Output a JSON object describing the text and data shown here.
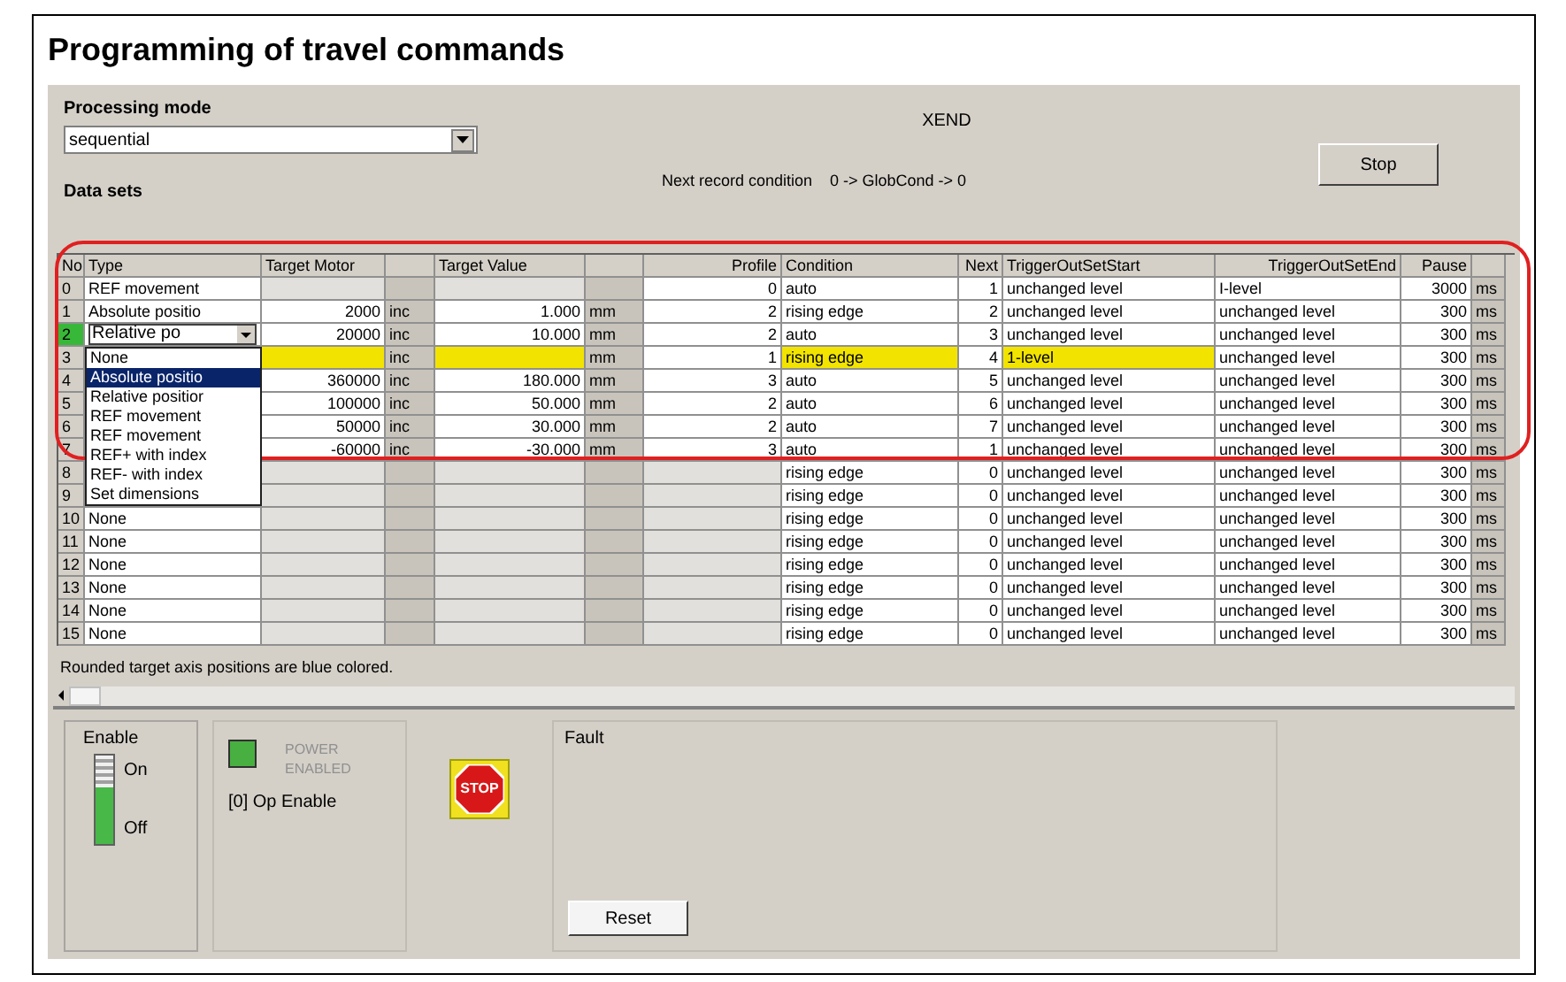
{
  "title": "Programming of travel commands",
  "processing_mode": {
    "label": "Processing mode",
    "value": "sequential"
  },
  "status": "XEND",
  "next_record_condition": {
    "label": "Next record condition",
    "value": "0 -> GlobCond -> 0"
  },
  "stop_button": "Stop",
  "data_sets": {
    "label": "Data sets",
    "columns": [
      "No",
      "Type",
      "Target Motor",
      "Target Value",
      "Profile",
      "Condition",
      "Next",
      "TriggerOutSetStart",
      "TriggerOutSetEnd",
      "Pause"
    ],
    "rows": [
      {
        "no": "0",
        "type": "REF movement",
        "profile": "0",
        "condition": "auto",
        "next": "1",
        "start": "unchanged level",
        "end": "I-level",
        "pause": "3000",
        "pause_unit": "ms",
        "selected": false,
        "warning": false
      },
      {
        "no": "1",
        "type": "Absolute positio",
        "motor": "2000",
        "motor_unit": "inc",
        "value": "1.000",
        "value_unit": "mm",
        "profile": "2",
        "condition": "rising edge",
        "next": "2",
        "start": "unchanged level",
        "end": "unchanged level",
        "pause": "300",
        "pause_unit": "ms",
        "selected": false,
        "warning": false
      },
      {
        "no": "2",
        "type": "Relative po",
        "motor": "20000",
        "motor_unit": "inc",
        "value": "10.000",
        "value_unit": "mm",
        "profile": "2",
        "condition": "auto",
        "next": "3",
        "start": "unchanged level",
        "end": "unchanged level",
        "pause": "300",
        "pause_unit": "ms",
        "selected": true,
        "warning": false
      },
      {
        "no": "3",
        "motor_unit": "inc",
        "value_unit": "mm",
        "profile": "1",
        "condition": "rising edge",
        "next": "4",
        "start": "1-level",
        "end": "unchanged level",
        "pause": "300",
        "pause_unit": "ms",
        "selected": false,
        "warning": true
      },
      {
        "no": "4",
        "motor": "360000",
        "motor_unit": "inc",
        "value": "180.000",
        "value_unit": "mm",
        "profile": "3",
        "condition": "auto",
        "next": "5",
        "start": "unchanged level",
        "end": "unchanged level",
        "pause": "300",
        "pause_unit": "ms",
        "selected": false,
        "warning": false
      },
      {
        "no": "5",
        "motor": "100000",
        "motor_unit": "inc",
        "value": "50.000",
        "value_unit": "mm",
        "profile": "2",
        "condition": "auto",
        "next": "6",
        "start": "unchanged level",
        "end": "unchanged level",
        "pause": "300",
        "pause_unit": "ms",
        "selected": false,
        "warning": false
      },
      {
        "no": "6",
        "motor": "50000",
        "motor_unit": "inc",
        "value": "30.000",
        "value_unit": "mm",
        "profile": "2",
        "condition": "auto",
        "next": "7",
        "start": "unchanged level",
        "end": "unchanged level",
        "pause": "300",
        "pause_unit": "ms",
        "selected": false,
        "warning": false
      },
      {
        "no": "7",
        "motor": "-60000",
        "motor_unit": "inc",
        "value": "-30.000",
        "value_unit": "mm",
        "profile": "3",
        "condition": "auto",
        "next": "1",
        "start": "unchanged level",
        "end": "unchanged level",
        "pause": "300",
        "pause_unit": "ms",
        "selected": false,
        "warning": false
      },
      {
        "no": "8",
        "condition": "rising edge",
        "next": "0",
        "start": "unchanged level",
        "end": "unchanged level",
        "pause": "300",
        "pause_unit": "ms",
        "selected": false,
        "warning": false
      },
      {
        "no": "9",
        "condition": "rising edge",
        "next": "0",
        "start": "unchanged level",
        "end": "unchanged level",
        "pause": "300",
        "pause_unit": "ms",
        "selected": false,
        "warning": false
      },
      {
        "no": "10",
        "type": "None",
        "condition": "rising edge",
        "next": "0",
        "start": "unchanged level",
        "end": "unchanged level",
        "pause": "300",
        "pause_unit": "ms",
        "selected": false,
        "warning": false
      },
      {
        "no": "11",
        "type": "None",
        "condition": "rising edge",
        "next": "0",
        "start": "unchanged level",
        "end": "unchanged level",
        "pause": "300",
        "pause_unit": "ms",
        "selected": false,
        "warning": false
      },
      {
        "no": "12",
        "type": "None",
        "condition": "rising edge",
        "next": "0",
        "start": "unchanged level",
        "end": "unchanged level",
        "pause": "300",
        "pause_unit": "ms",
        "selected": false,
        "warning": false
      },
      {
        "no": "13",
        "type": "None",
        "condition": "rising edge",
        "next": "0",
        "start": "unchanged level",
        "end": "unchanged level",
        "pause": "300",
        "pause_unit": "ms",
        "selected": false,
        "warning": false
      },
      {
        "no": "14",
        "type": "None",
        "condition": "rising edge",
        "next": "0",
        "start": "unchanged level",
        "end": "unchanged level",
        "pause": "300",
        "pause_unit": "ms",
        "selected": false,
        "warning": false
      },
      {
        "no": "15",
        "type": "None",
        "condition": "rising edge",
        "next": "0",
        "start": "unchanged level",
        "end": "unchanged level",
        "pause": "300",
        "pause_unit": "ms",
        "selected": false,
        "warning": false
      }
    ]
  },
  "type_dropdown": {
    "options": [
      {
        "label": "None",
        "selected": false
      },
      {
        "label": "Absolute positio",
        "selected": true
      },
      {
        "label": "Relative positior",
        "selected": false
      },
      {
        "label": "REF movement",
        "selected": false
      },
      {
        "label": "REF movement",
        "selected": false
      },
      {
        "label": "REF+ with index",
        "selected": false
      },
      {
        "label": "REF- with index",
        "selected": false
      },
      {
        "label": "Set dimensions",
        "selected": false
      }
    ]
  },
  "note": "Rounded target axis positions are blue colored.",
  "enable": {
    "label": "Enable",
    "on_label": "On",
    "off_label": "Off"
  },
  "power": {
    "label": "POWER ENABLED",
    "lit": true
  },
  "op_enable": "[0] Op Enable",
  "stop_icon": "STOP",
  "fault": {
    "label": "Fault",
    "button": "Reset"
  }
}
